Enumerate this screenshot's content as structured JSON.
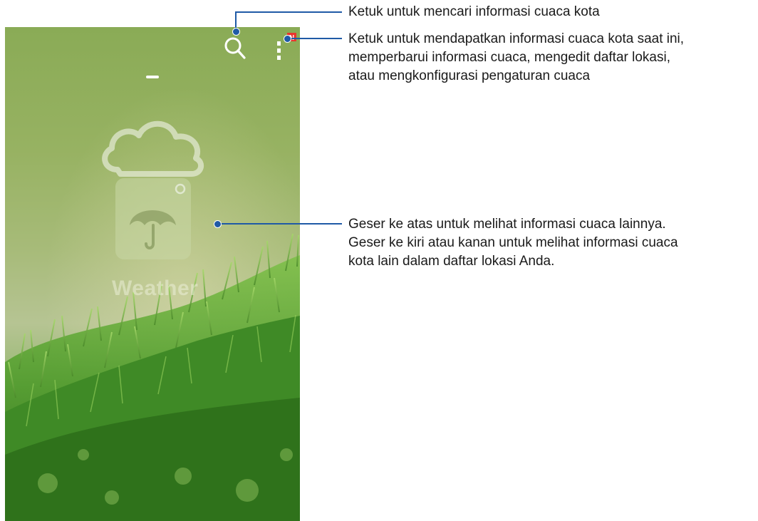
{
  "app": {
    "wordmark": "Weather"
  },
  "toolbar": {
    "search_icon": "search-icon",
    "menu_icon": "overflow-menu-icon",
    "menu_badge_color": "#e8352e"
  },
  "callouts": {
    "search": {
      "text": "Ketuk untuk mencari informasi cuaca kota"
    },
    "menu": {
      "lines": [
        "Ketuk untuk mendapatkan informasi cuaca kota saat ini,",
        "memperbarui informasi cuaca, mengedit daftar lokasi,",
        "atau mengkonfigurasi pengaturan cuaca"
      ]
    },
    "swipe": {
      "lines": [
        "Geser ke atas untuk melihat informasi cuaca lainnya.",
        "Geser ke kiri atau kanan untuk melihat informasi cuaca",
        "kota lain dalam daftar lokasi Anda."
      ]
    }
  },
  "colors": {
    "callout_accent": "#1f5aa6",
    "background_green": "#8aab56"
  }
}
